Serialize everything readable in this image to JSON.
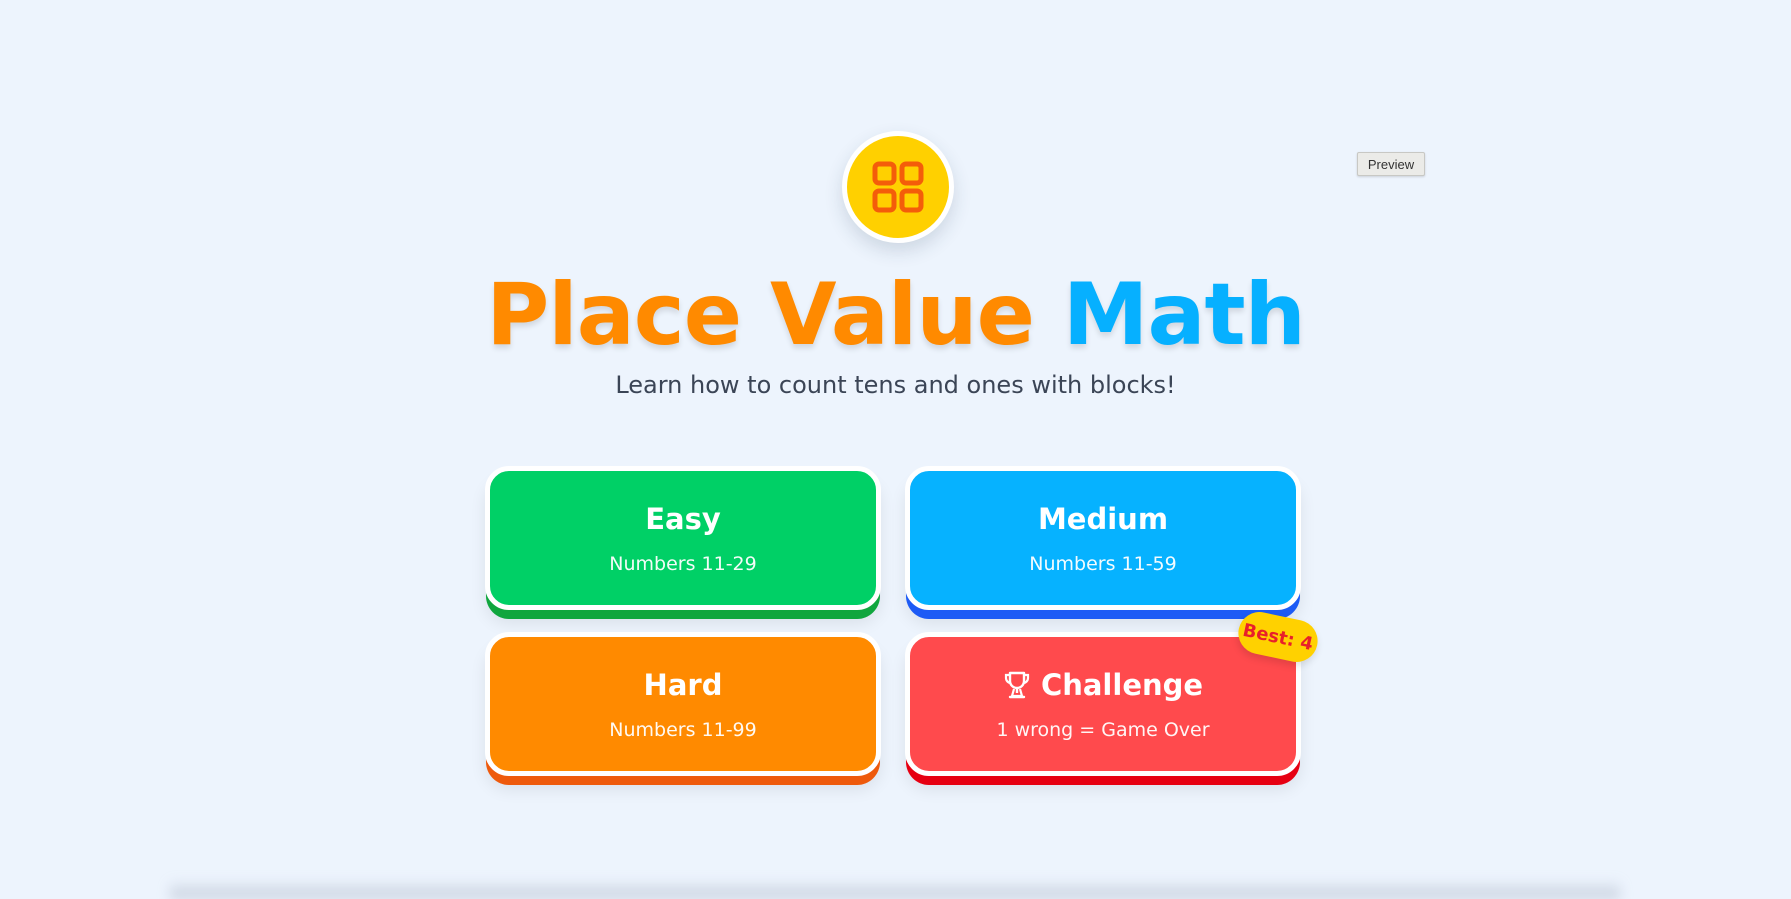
{
  "colors": {
    "background": "#edf4fd",
    "title_orange": "#ff8a00",
    "title_blue": "#06b0ff",
    "logo_yellow": "#ffd000",
    "logo_icon": "#f45d0a",
    "easy": "#00d066",
    "medium": "#06b2ff",
    "hard": "#ff8a00",
    "challenge": "#ff4a4d",
    "badge": "#ffd100",
    "badge_text": "#e8202a"
  },
  "logo": {
    "icon": "grid-blocks-icon"
  },
  "preview_button": {
    "label": "Preview"
  },
  "title": {
    "part1": "Place Value",
    "part2": "Math"
  },
  "subtitle": "Learn how to count tens and ones with blocks!",
  "modes": [
    {
      "id": "easy",
      "title": "Easy",
      "subtitle": "Numbers 11-29"
    },
    {
      "id": "medium",
      "title": "Medium",
      "subtitle": "Numbers 11-59"
    },
    {
      "id": "hard",
      "title": "Hard",
      "subtitle": "Numbers 11-99"
    },
    {
      "id": "challenge",
      "title": "Challenge",
      "subtitle": "1 wrong = Game Over",
      "icon": "trophy-icon",
      "badge": "Best: 4"
    }
  ]
}
